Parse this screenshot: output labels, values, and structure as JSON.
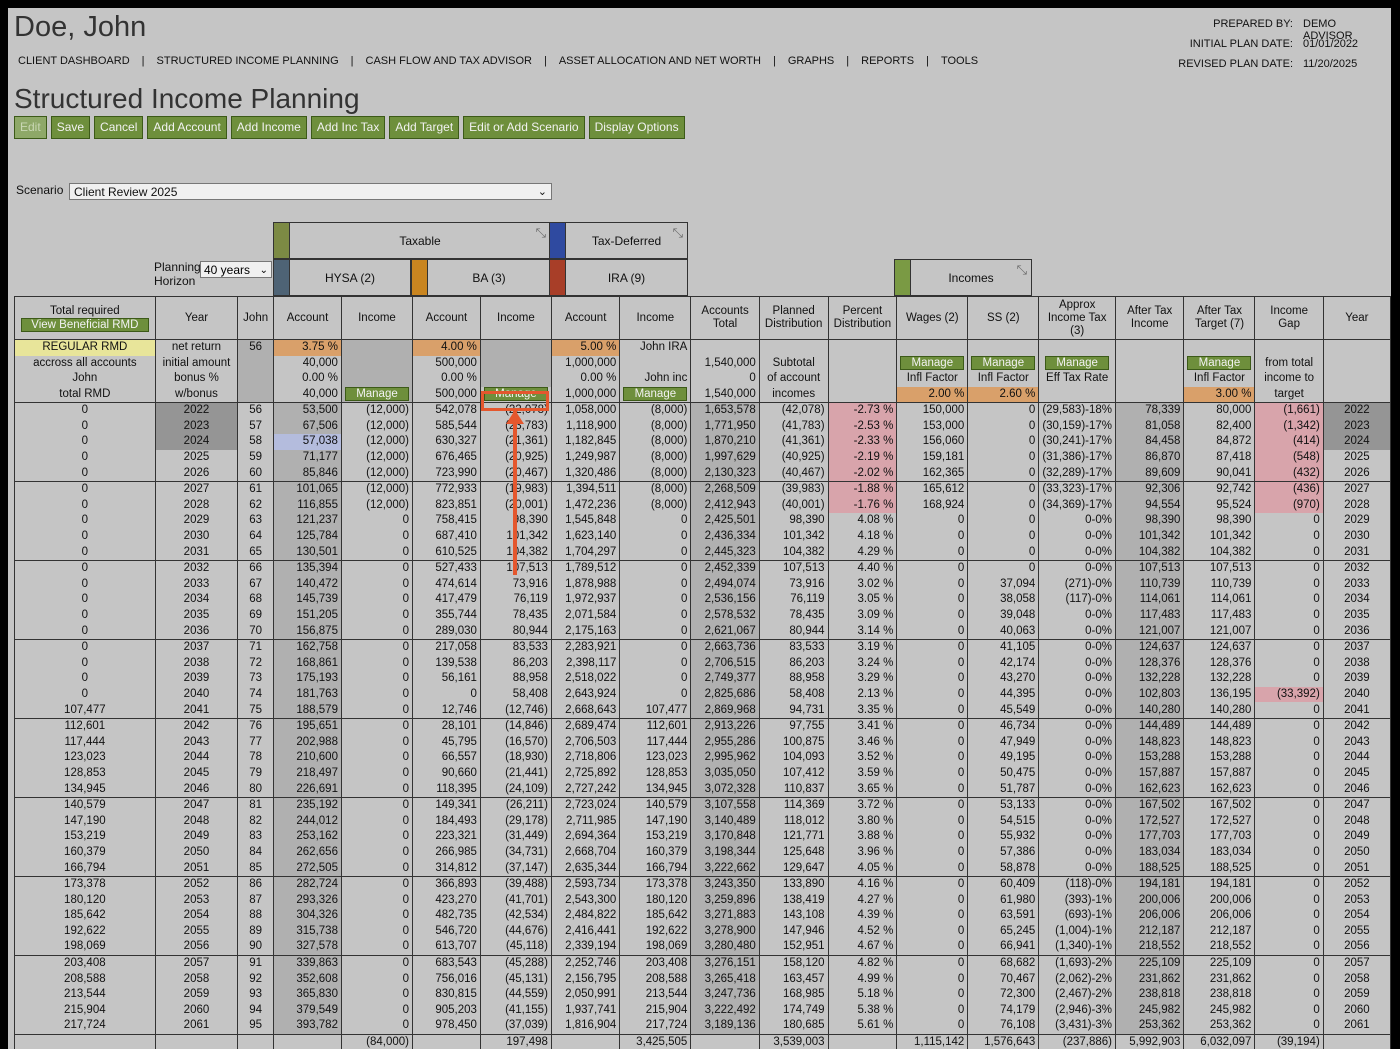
{
  "header": {
    "client_name": "Doe, John",
    "nav": [
      "CLIENT DASHBOARD",
      "STRUCTURED INCOME PLANNING",
      "CASH FLOW AND TAX ADVISOR",
      "ASSET ALLOCATION AND NET WORTH",
      "GRAPHS",
      "REPORTS",
      "TOOLS"
    ],
    "prepared_by_label": "PREPARED BY:",
    "prepared_by": "DEMO ADVISOR",
    "initial_label": "INITIAL PLAN DATE:",
    "initial_date": "01/01/2022",
    "revised_label": "REVISED PLAN DATE:",
    "revised_date": "11/20/2025"
  },
  "page_title": "Structured Income Planning",
  "toolbar": [
    "Edit",
    "Save",
    "Cancel",
    "Add Account",
    "Add Income",
    "Add Inc Tax",
    "Add Target",
    "Edit or Add Scenario",
    "Display Options"
  ],
  "scenario": {
    "label": "Scenario",
    "value": "Client Review 2025"
  },
  "horizon": {
    "label": "Planning Horizon",
    "value": "40 years"
  },
  "groups": {
    "taxable": "Taxable",
    "tax_deferred": "Tax-Deferred",
    "hysa": "HYSA (2)",
    "ba": "BA (3)",
    "ira": "IRA (9)",
    "incomes": "Incomes"
  },
  "colors": {
    "bg": "#c5c5c5",
    "button": "#6e8f3c",
    "highlight": "#e4572e",
    "taxable": "#7c8a44",
    "tax_deferred": "#2f4aa0",
    "hysa": "#4e6375",
    "ba": "#c98520",
    "ira": "#a83e28",
    "incomes": "#7a9a44"
  },
  "columns": [
    "Total required",
    "Year",
    "John",
    "Account",
    "Income",
    "Account",
    "Income",
    "Account",
    "Income",
    "Accounts Total",
    "Planned Distribution",
    "Percent Distribution",
    "Wages (2)",
    "SS (2)",
    "Approx Income Tax (3)",
    "After Tax Income",
    "After Tax Target (7)",
    "Income Gap",
    "Year"
  ],
  "view_rmd_button": "View Beneficial RMD",
  "config_rows": [
    [
      "REGULAR RMD",
      "net return",
      "56",
      "3.75  %",
      "",
      "4.00  %",
      "",
      "5.00  %",
      "John IRA",
      "",
      "",
      "",
      "",
      "",
      "",
      "",
      "",
      "",
      ""
    ],
    [
      "accross all accounts",
      "initial amount",
      "",
      "40,000",
      "",
      "500,000",
      "",
      "1,000,000",
      "",
      "1,540,000",
      "Subtotal",
      "",
      "Manage",
      "Manage",
      "Manage",
      "",
      "Manage",
      "from total",
      ""
    ],
    [
      "John",
      "bonus %",
      "",
      "0.00  %",
      "",
      "0.00  %",
      "",
      "0.00  %",
      "John inc",
      "0",
      "of account",
      "",
      "Infl Factor",
      "Infl Factor",
      "Eff Tax Rate",
      "",
      "Infl Factor",
      "income to",
      ""
    ],
    [
      "total RMD",
      "w/bonus",
      "",
      "40,000",
      "Manage",
      "500,000",
      "Manage",
      "1,000,000",
      "Manage",
      "1,540,000",
      "incomes",
      "",
      "2.00  %",
      "2.60  %",
      "",
      "",
      "3.00  %",
      "target",
      ""
    ]
  ],
  "rows": [
    [
      "0",
      "2022",
      "56",
      "53,500",
      "(12,000)",
      "542,078",
      "(22,078)",
      "1,058,000",
      "(8,000)",
      "1,653,578",
      "(42,078)",
      "-2.73  %",
      "150,000",
      "0",
      "(29,583)-18%",
      "78,339",
      "80,000",
      "(1,661)",
      "2022"
    ],
    [
      "0",
      "2023",
      "57",
      "67,506",
      "(12,000)",
      "585,544",
      "(23,783)",
      "1,118,900",
      "(8,000)",
      "1,771,950",
      "(41,783)",
      "-2.53  %",
      "153,000",
      "0",
      "(30,159)-17%",
      "81,058",
      "82,400",
      "(1,342)",
      "2023"
    ],
    [
      "0",
      "2024",
      "58",
      "57,038",
      "(12,000)",
      "630,327",
      "(21,361)",
      "1,182,845",
      "(8,000)",
      "1,870,210",
      "(41,361)",
      "-2.33  %",
      "156,060",
      "0",
      "(30,241)-17%",
      "84,458",
      "84,872",
      "(414)",
      "2024"
    ],
    [
      "0",
      "2025",
      "59",
      "71,177",
      "(12,000)",
      "676,465",
      "(20,925)",
      "1,249,987",
      "(8,000)",
      "1,997,629",
      "(40,925)",
      "-2.19  %",
      "159,181",
      "0",
      "(31,386)-17%",
      "86,870",
      "87,418",
      "(548)",
      "2025"
    ],
    [
      "0",
      "2026",
      "60",
      "85,846",
      "(12,000)",
      "723,990",
      "(20,467)",
      "1,320,486",
      "(8,000)",
      "2,130,323",
      "(40,467)",
      "-2.02  %",
      "162,365",
      "0",
      "(32,289)-17%",
      "89,609",
      "90,041",
      "(432)",
      "2026"
    ],
    [
      "0",
      "2027",
      "61",
      "101,065",
      "(12,000)",
      "772,933",
      "(19,983)",
      "1,394,511",
      "(8,000)",
      "2,268,509",
      "(39,983)",
      "-1.88  %",
      "165,612",
      "0",
      "(33,323)-17%",
      "92,306",
      "92,742",
      "(436)",
      "2027"
    ],
    [
      "0",
      "2028",
      "62",
      "116,855",
      "(12,000)",
      "823,851",
      "(20,001)",
      "1,472,236",
      "(8,000)",
      "2,412,943",
      "(40,001)",
      "-1.76  %",
      "168,924",
      "0",
      "(34,369)-17%",
      "94,554",
      "95,524",
      "(970)",
      "2028"
    ],
    [
      "0",
      "2029",
      "63",
      "121,237",
      "0",
      "758,415",
      "98,390",
      "1,545,848",
      "0",
      "2,425,501",
      "98,390",
      "4.08  %",
      "0",
      "0",
      "0-0%",
      "98,390",
      "98,390",
      "0",
      "2029"
    ],
    [
      "0",
      "2030",
      "64",
      "125,784",
      "0",
      "687,410",
      "101,342",
      "1,623,140",
      "0",
      "2,436,334",
      "101,342",
      "4.18  %",
      "0",
      "0",
      "0-0%",
      "101,342",
      "101,342",
      "0",
      "2030"
    ],
    [
      "0",
      "2031",
      "65",
      "130,501",
      "0",
      "610,525",
      "104,382",
      "1,704,297",
      "0",
      "2,445,323",
      "104,382",
      "4.29  %",
      "0",
      "0",
      "0-0%",
      "104,382",
      "104,382",
      "0",
      "2031"
    ],
    [
      "0",
      "2032",
      "66",
      "135,394",
      "0",
      "527,433",
      "107,513",
      "1,789,512",
      "0",
      "2,452,339",
      "107,513",
      "4.40  %",
      "0",
      "0",
      "0-0%",
      "107,513",
      "107,513",
      "0",
      "2032"
    ],
    [
      "0",
      "2033",
      "67",
      "140,472",
      "0",
      "474,614",
      "73,916",
      "1,878,988",
      "0",
      "2,494,074",
      "73,916",
      "3.02  %",
      "0",
      "37,094",
      "(271)-0%",
      "110,739",
      "110,739",
      "0",
      "2033"
    ],
    [
      "0",
      "2034",
      "68",
      "145,739",
      "0",
      "417,479",
      "76,119",
      "1,972,937",
      "0",
      "2,536,156",
      "76,119",
      "3.05  %",
      "0",
      "38,058",
      "(117)-0%",
      "114,061",
      "114,061",
      "0",
      "2034"
    ],
    [
      "0",
      "2035",
      "69",
      "151,205",
      "0",
      "355,744",
      "78,435",
      "2,071,584",
      "0",
      "2,578,532",
      "78,435",
      "3.09  %",
      "0",
      "39,048",
      "0-0%",
      "117,483",
      "117,483",
      "0",
      "2035"
    ],
    [
      "0",
      "2036",
      "70",
      "156,875",
      "0",
      "289,030",
      "80,944",
      "2,175,163",
      "0",
      "2,621,067",
      "80,944",
      "3.14  %",
      "0",
      "40,063",
      "0-0%",
      "121,007",
      "121,007",
      "0",
      "2036"
    ],
    [
      "0",
      "2037",
      "71",
      "162,758",
      "0",
      "217,058",
      "83,533",
      "2,283,921",
      "0",
      "2,663,736",
      "83,533",
      "3.19  %",
      "0",
      "41,105",
      "0-0%",
      "124,637",
      "124,637",
      "0",
      "2037"
    ],
    [
      "0",
      "2038",
      "72",
      "168,861",
      "0",
      "139,538",
      "86,203",
      "2,398,117",
      "0",
      "2,706,515",
      "86,203",
      "3.24  %",
      "0",
      "42,174",
      "0-0%",
      "128,376",
      "128,376",
      "0",
      "2038"
    ],
    [
      "0",
      "2039",
      "73",
      "175,193",
      "0",
      "56,161",
      "88,958",
      "2,518,022",
      "0",
      "2,749,377",
      "88,958",
      "3.29  %",
      "0",
      "43,270",
      "0-0%",
      "132,228",
      "132,228",
      "0",
      "2039"
    ],
    [
      "0",
      "2040",
      "74",
      "181,763",
      "0",
      "0",
      "58,408",
      "2,643,924",
      "0",
      "2,825,686",
      "58,408",
      "2.13  %",
      "0",
      "44,395",
      "0-0%",
      "102,803",
      "136,195",
      "(33,392)",
      "2040"
    ],
    [
      "107,477",
      "2041",
      "75",
      "188,579",
      "0",
      "12,746",
      "(12,746)",
      "2,668,643",
      "107,477",
      "2,869,968",
      "94,731",
      "3.35  %",
      "0",
      "45,549",
      "0-0%",
      "140,280",
      "140,280",
      "0",
      "2041"
    ],
    [
      "112,601",
      "2042",
      "76",
      "195,651",
      "0",
      "28,101",
      "(14,846)",
      "2,689,474",
      "112,601",
      "2,913,226",
      "97,755",
      "3.41  %",
      "0",
      "46,734",
      "0-0%",
      "144,489",
      "144,489",
      "0",
      "2042"
    ],
    [
      "117,444",
      "2043",
      "77",
      "202,988",
      "0",
      "45,795",
      "(16,570)",
      "2,706,503",
      "117,444",
      "2,955,286",
      "100,875",
      "3.46  %",
      "0",
      "47,949",
      "0-0%",
      "148,823",
      "148,823",
      "0",
      "2043"
    ],
    [
      "123,023",
      "2044",
      "78",
      "210,600",
      "0",
      "66,557",
      "(18,930)",
      "2,718,806",
      "123,023",
      "2,995,962",
      "104,093",
      "3.52  %",
      "0",
      "49,195",
      "0-0%",
      "153,288",
      "153,288",
      "0",
      "2044"
    ],
    [
      "128,853",
      "2045",
      "79",
      "218,497",
      "0",
      "90,660",
      "(21,441)",
      "2,725,892",
      "128,853",
      "3,035,050",
      "107,412",
      "3.59  %",
      "0",
      "50,475",
      "0-0%",
      "157,887",
      "157,887",
      "0",
      "2045"
    ],
    [
      "134,945",
      "2046",
      "80",
      "226,691",
      "0",
      "118,395",
      "(24,109)",
      "2,727,242",
      "134,945",
      "3,072,328",
      "110,837",
      "3.65  %",
      "0",
      "51,787",
      "0-0%",
      "162,623",
      "162,623",
      "0",
      "2046"
    ],
    [
      "140,579",
      "2047",
      "81",
      "235,192",
      "0",
      "149,341",
      "(26,211)",
      "2,723,024",
      "140,579",
      "3,107,558",
      "114,369",
      "3.72  %",
      "0",
      "53,133",
      "0-0%",
      "167,502",
      "167,502",
      "0",
      "2047"
    ],
    [
      "147,190",
      "2048",
      "82",
      "244,012",
      "0",
      "184,493",
      "(29,178)",
      "2,711,985",
      "147,190",
      "3,140,489",
      "118,012",
      "3.80  %",
      "0",
      "54,515",
      "0-0%",
      "172,527",
      "172,527",
      "0",
      "2048"
    ],
    [
      "153,219",
      "2049",
      "83",
      "253,162",
      "0",
      "223,321",
      "(31,449)",
      "2,694,364",
      "153,219",
      "3,170,848",
      "121,771",
      "3.88  %",
      "0",
      "55,932",
      "0-0%",
      "177,703",
      "177,703",
      "0",
      "2049"
    ],
    [
      "160,379",
      "2050",
      "84",
      "262,656",
      "0",
      "266,985",
      "(34,731)",
      "2,668,704",
      "160,379",
      "3,198,344",
      "125,648",
      "3.96  %",
      "0",
      "57,386",
      "0-0%",
      "183,034",
      "183,034",
      "0",
      "2050"
    ],
    [
      "166,794",
      "2051",
      "85",
      "272,505",
      "0",
      "314,812",
      "(37,147)",
      "2,635,344",
      "166,794",
      "3,222,662",
      "129,647",
      "4.05  %",
      "0",
      "58,878",
      "0-0%",
      "188,525",
      "188,525",
      "0",
      "2051"
    ],
    [
      "173,378",
      "2052",
      "86",
      "282,724",
      "0",
      "366,893",
      "(39,488)",
      "2,593,734",
      "173,378",
      "3,243,350",
      "133,890",
      "4.16  %",
      "0",
      "60,409",
      "(118)-0%",
      "194,181",
      "194,181",
      "0",
      "2052"
    ],
    [
      "180,120",
      "2053",
      "87",
      "293,326",
      "0",
      "423,270",
      "(41,701)",
      "2,543,300",
      "180,120",
      "3,259,896",
      "138,419",
      "4.27  %",
      "0",
      "61,980",
      "(393)-1%",
      "200,006",
      "200,006",
      "0",
      "2053"
    ],
    [
      "185,642",
      "2054",
      "88",
      "304,326",
      "0",
      "482,735",
      "(42,534)",
      "2,484,822",
      "185,642",
      "3,271,883",
      "143,108",
      "4.39  %",
      "0",
      "63,591",
      "(693)-1%",
      "206,006",
      "206,006",
      "0",
      "2054"
    ],
    [
      "192,622",
      "2055",
      "89",
      "315,738",
      "0",
      "546,720",
      "(44,676)",
      "2,416,441",
      "192,622",
      "3,278,900",
      "147,946",
      "4.52  %",
      "0",
      "65,245",
      "(1,004)-1%",
      "212,187",
      "212,187",
      "0",
      "2055"
    ],
    [
      "198,069",
      "2056",
      "90",
      "327,578",
      "0",
      "613,707",
      "(45,118)",
      "2,339,194",
      "198,069",
      "3,280,480",
      "152,951",
      "4.67  %",
      "0",
      "66,941",
      "(1,340)-1%",
      "218,552",
      "218,552",
      "0",
      "2056"
    ],
    [
      "203,408",
      "2057",
      "91",
      "339,863",
      "0",
      "683,543",
      "(45,288)",
      "2,252,746",
      "203,408",
      "3,276,151",
      "158,120",
      "4.82  %",
      "0",
      "68,682",
      "(1,693)-2%",
      "225,109",
      "225,109",
      "0",
      "2057"
    ],
    [
      "208,588",
      "2058",
      "92",
      "352,608",
      "0",
      "756,016",
      "(45,131)",
      "2,156,795",
      "208,588",
      "3,265,418",
      "163,457",
      "4.99  %",
      "0",
      "70,467",
      "(2,062)-2%",
      "231,862",
      "231,862",
      "0",
      "2058"
    ],
    [
      "213,544",
      "2059",
      "93",
      "365,830",
      "0",
      "830,815",
      "(44,559)",
      "2,050,991",
      "213,544",
      "3,247,736",
      "168,985",
      "5.18  %",
      "0",
      "72,300",
      "(2,467)-2%",
      "238,818",
      "238,818",
      "0",
      "2059"
    ],
    [
      "215,904",
      "2060",
      "94",
      "379,549",
      "0",
      "905,203",
      "(41,155)",
      "1,937,741",
      "215,904",
      "3,222,492",
      "174,749",
      "5.38  %",
      "0",
      "74,179",
      "(2,946)-3%",
      "245,982",
      "245,982",
      "0",
      "2060"
    ],
    [
      "217,724",
      "2061",
      "95",
      "393,782",
      "0",
      "978,450",
      "(37,039)",
      "1,816,904",
      "217,724",
      "3,189,136",
      "180,685",
      "5.61  %",
      "0",
      "76,108",
      "(3,431)-3%",
      "253,362",
      "253,362",
      "0",
      "2061"
    ]
  ],
  "totals": [
    "",
    "",
    "",
    "",
    "(84,000)",
    "",
    "197,498",
    "",
    "3,425,505",
    "",
    "3,539,003",
    "",
    "1,115,142",
    "1,576,643",
    "(237,886)",
    "5,992,903",
    "6,032,097",
    "(39,194)",
    ""
  ]
}
